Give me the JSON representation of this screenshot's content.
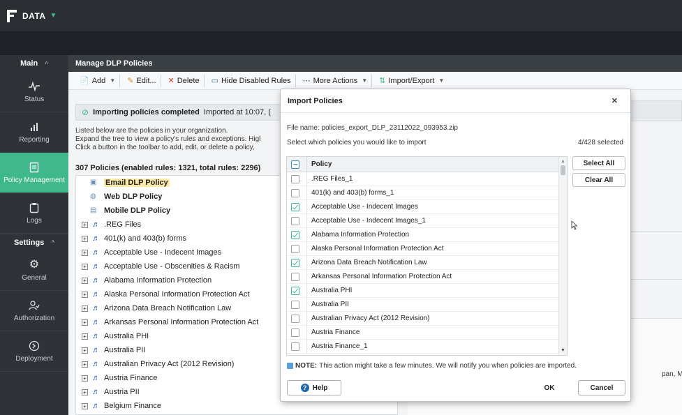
{
  "topbar": {
    "brand": "DATA"
  },
  "sidebar": {
    "main_label": "Main",
    "settings_label": "Settings",
    "items": [
      {
        "label": "Status",
        "icon": "pulse-icon"
      },
      {
        "label": "Reporting",
        "icon": "bar-chart-icon"
      },
      {
        "label": "Policy Management",
        "icon": "document-icon",
        "active": true
      },
      {
        "label": "Logs",
        "icon": "clipboard-icon"
      }
    ],
    "settings_items": [
      {
        "label": "General",
        "icon": "gear-icon"
      },
      {
        "label": "Authorization",
        "icon": "user-key-icon"
      },
      {
        "label": "Deployment",
        "icon": "arrow-circle-icon"
      }
    ]
  },
  "main": {
    "title": "Manage DLP Policies",
    "toolbar": {
      "add": "Add",
      "edit": "Edit...",
      "delete": "Delete",
      "hide_disabled": "Hide Disabled Rules",
      "more_actions": "More Actions",
      "import_export": "Import/Export"
    },
    "notice": {
      "bold": "Importing policies completed",
      "rest": "Imported at 10:07, ("
    },
    "description": [
      "Listed below are the policies in your organization.",
      "Expand the tree to view a policy's rules and exceptions. Higl",
      "Click a button in the toolbar to add, edit, or delete a policy,"
    ],
    "count_text": "307 Policies (enabled rules: 1321, total rules: 2296)",
    "top_policies": [
      {
        "label": "Email DLP Policy",
        "selected": true
      },
      {
        "label": "Web DLP Policy"
      },
      {
        "label": "Mobile DLP Policy"
      }
    ],
    "tree_items": [
      ".REG Files",
      "401(k) and 403(b) forms",
      "Acceptable Use - Indecent Images",
      "Acceptable Use - Obscenities & Racism",
      "Alabama Information Protection",
      "Alaska Personal Information Protection Act",
      "Arizona Data Breach Notification Law",
      "Arkansas Personal Information Protection Act",
      "Australia PHI",
      "Australia PII",
      "Australian Privacy Act (2012 Revision)",
      "Austria Finance",
      "Austria PII",
      "Belgium Finance"
    ],
    "right_truncated": "pan, Macau, Ma"
  },
  "modal": {
    "title": "Import Policies",
    "file_name": "File name: policies_export_DLP_23112022_093953.zip",
    "select_prompt": "Select which policies you would like to import",
    "selected_count": "4/428 selected",
    "column_header": "Policy",
    "rows": [
      {
        "label": ".REG Files_1",
        "checked": false
      },
      {
        "label": "401(k) and 403(b) forms_1",
        "checked": false
      },
      {
        "label": "Acceptable Use - Indecent Images",
        "checked": true
      },
      {
        "label": "Acceptable Use - Indecent Images_1",
        "checked": false
      },
      {
        "label": "Alabama Information Protection",
        "checked": true
      },
      {
        "label": "Alaska Personal Information Protection Act",
        "checked": false
      },
      {
        "label": "Arizona Data Breach Notification Law",
        "checked": true
      },
      {
        "label": "Arkansas Personal Information Protection Act",
        "checked": false
      },
      {
        "label": "Australia PHI",
        "checked": true
      },
      {
        "label": "Australia PII",
        "checked": false
      },
      {
        "label": "Australian Privacy Act (2012 Revision)",
        "checked": false
      },
      {
        "label": "Austria Finance",
        "checked": false
      },
      {
        "label": "Austria Finance_1",
        "checked": false
      }
    ],
    "select_all": "Select All",
    "clear_all": "Clear All",
    "note_bold": "NOTE:",
    "note_text": "This action might take a few minutes. We will notify you when policies are imported.",
    "help": "Help",
    "ok": "OK",
    "cancel": "Cancel"
  },
  "colors": {
    "accent": "#3fb88c",
    "topbar": "#2b2f33",
    "sidebar": "#2f3337"
  }
}
